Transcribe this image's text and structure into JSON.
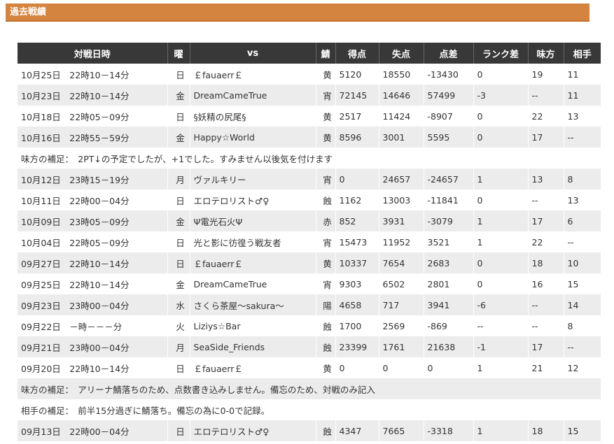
{
  "section": {
    "title": "過去戦績"
  },
  "columns": [
    "対戦日時",
    "曜",
    "vs",
    "鯖",
    "得点",
    "失点",
    "点差",
    "ランク差",
    "味方",
    "相手"
  ],
  "rows": [
    {
      "kind": "match",
      "datetime": "10月25日　22時10－14分",
      "day": "日",
      "vs": "￡fauaerr￡",
      "server": "黄",
      "score": "5120",
      "lost": "18550",
      "diff": "-13430",
      "rank": "0",
      "ally": "19",
      "opp": "11"
    },
    {
      "kind": "match",
      "datetime": "10月23日　22時10－14分",
      "day": "金",
      "vs": "DreamCameTrue",
      "server": "宵",
      "score": "72145",
      "lost": "14646",
      "diff": "57499",
      "rank": "-3",
      "ally": "--",
      "opp": "11"
    },
    {
      "kind": "match",
      "datetime": "10月18日　22時05－09分",
      "day": "日",
      "vs": "§妖精の尻尾§",
      "server": "黄",
      "score": "2517",
      "lost": "11424",
      "diff": "-8907",
      "rank": "0",
      "ally": "22",
      "opp": "13"
    },
    {
      "kind": "match",
      "datetime": "10月16日　22時55－59分",
      "day": "金",
      "vs": "Happy☆World",
      "server": "黄",
      "score": "8596",
      "lost": "3001",
      "diff": "5595",
      "rank": "0",
      "ally": "17",
      "opp": "--"
    },
    {
      "kind": "note",
      "text": "味方の補足：　2PT↓の予定でしたが、+1でした。すみません以後気を付けます"
    },
    {
      "kind": "match",
      "datetime": "10月12日　23時15－19分",
      "day": "月",
      "vs": "ヴァルキリー",
      "server": "宵",
      "score": "0",
      "lost": "24657",
      "diff": "-24657",
      "rank": "1",
      "ally": "13",
      "opp": "8"
    },
    {
      "kind": "match",
      "datetime": "10月11日　22時00－04分",
      "day": "日",
      "vs": "エロテロリスト♂♀",
      "server": "蝕",
      "score": "1162",
      "lost": "13003",
      "diff": "-11841",
      "rank": "0",
      "ally": "--",
      "opp": "13"
    },
    {
      "kind": "match",
      "datetime": "10月09日　23時05－09分",
      "day": "金",
      "vs": "Ψ電光石火Ψ",
      "server": "赤",
      "score": "852",
      "lost": "3931",
      "diff": "-3079",
      "rank": "1",
      "ally": "17",
      "opp": "6"
    },
    {
      "kind": "match",
      "datetime": "10月04日　22時05－09分",
      "day": "日",
      "vs": "光と影に彷徨う戦友者",
      "server": "宵",
      "score": "15473",
      "lost": "11952",
      "diff": "3521",
      "rank": "1",
      "ally": "22",
      "opp": "--"
    },
    {
      "kind": "match",
      "datetime": "09月27日　22時10－14分",
      "day": "日",
      "vs": "￡fauaerr￡",
      "server": "黄",
      "score": "10337",
      "lost": "7654",
      "diff": "2683",
      "rank": "0",
      "ally": "18",
      "opp": "10"
    },
    {
      "kind": "match",
      "datetime": "09月25日　22時10－14分",
      "day": "金",
      "vs": "DreamCameTrue",
      "server": "宵",
      "score": "9303",
      "lost": "6502",
      "diff": "2801",
      "rank": "0",
      "ally": "16",
      "opp": "15"
    },
    {
      "kind": "match",
      "datetime": "09月23日　23時00－04分",
      "day": "水",
      "vs": "さくら茶屋～sakura～",
      "server": "陽",
      "score": "4658",
      "lost": "717",
      "diff": "3941",
      "rank": "-6",
      "ally": "--",
      "opp": "14"
    },
    {
      "kind": "match",
      "datetime": "09月22日　－時－－－分",
      "day": "火",
      "vs": "Liziys☆Bar",
      "server": "蝕",
      "score": "1700",
      "lost": "2569",
      "diff": "-869",
      "rank": "--",
      "ally": "--",
      "opp": "8"
    },
    {
      "kind": "match",
      "datetime": "09月21日　23時00－04分",
      "day": "月",
      "vs": "SeaSide_Friends",
      "server": "蝕",
      "score": "23399",
      "lost": "1761",
      "diff": "21638",
      "rank": "-1",
      "ally": "17",
      "opp": "--"
    },
    {
      "kind": "match",
      "datetime": "09月20日　22時10－14分",
      "day": "日",
      "vs": "￡fauaerr￡",
      "server": "黄",
      "score": "0",
      "lost": "0",
      "diff": "0",
      "rank": "1",
      "ally": "21",
      "opp": "12"
    },
    {
      "kind": "note",
      "text": "味方の補足：　アリーナ鯖落ちのため、点数書き込みしません。備忘のため、対戦のみ記入"
    },
    {
      "kind": "note",
      "text": "相手の補足：　前半15分過ぎに鯖落ち。備忘の為に0-0で記録。"
    },
    {
      "kind": "match",
      "datetime": "09月13日　22時00－04分",
      "day": "日",
      "vs": "エロテロリスト♂♀",
      "server": "蝕",
      "score": "4347",
      "lost": "7665",
      "diff": "-3318",
      "rank": "1",
      "ally": "18",
      "opp": "15"
    }
  ]
}
